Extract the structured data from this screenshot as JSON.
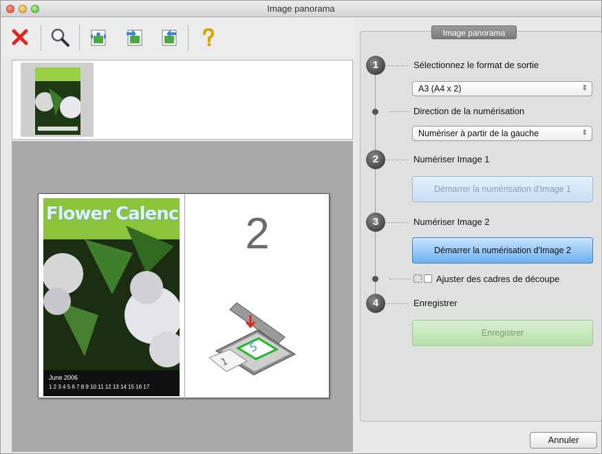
{
  "window": {
    "title": "Image panorama"
  },
  "toolbar": {
    "items": [
      "close-icon",
      "zoom-icon",
      "image-tool-icon-1",
      "image-tool-icon-2",
      "image-tool-icon-3",
      "help-icon"
    ]
  },
  "preview": {
    "photo_title": "Flower Calenc",
    "photo_caption": "June 2006",
    "photo_days": "1 2 3 4 5 6 7 8 9 10 11 12 13 14 15 16 17",
    "placeholder_number": "2"
  },
  "panel": {
    "tab_label": "Image panorama",
    "steps": [
      {
        "number": "1",
        "label": "Sélectionnez le format de sortie",
        "select_value": "A3 (A4 x 2)"
      },
      {
        "sub_label": "Direction de la numérisation",
        "select_value": "Numériser à partir de la gauche"
      },
      {
        "number": "2",
        "label": "Numériser Image 1",
        "button": "Démarrer la numérisation d'Image 1"
      },
      {
        "number": "3",
        "label": "Numériser Image 2",
        "button": "Démarrer la numérisation d'Image 2"
      },
      {
        "checkbox_label": "Ajuster des cadres de découpe"
      },
      {
        "number": "4",
        "label": "Enregistrer",
        "button": "Enregistrer"
      }
    ]
  },
  "footer": {
    "cancel_label": "Annuler"
  },
  "colors": {
    "accent_blue": "#6cb2f2",
    "save_green": "#b6e0a8",
    "close_red": "#e0261e"
  }
}
